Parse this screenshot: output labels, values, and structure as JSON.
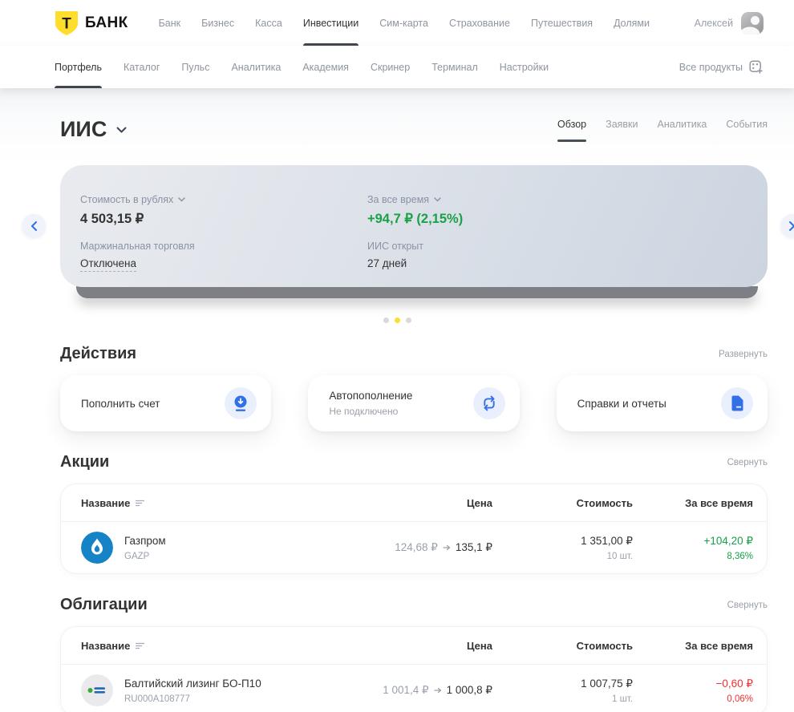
{
  "header": {
    "logo_letter": "Т",
    "logo_text": "БАНК",
    "nav": {
      "items": [
        {
          "label": "Банк"
        },
        {
          "label": "Бизнес"
        },
        {
          "label": "Касса"
        },
        {
          "label": "Инвестиции",
          "active": true
        },
        {
          "label": "Сим-карта"
        },
        {
          "label": "Страхование"
        },
        {
          "label": "Путешествия"
        },
        {
          "label": "Долями"
        }
      ]
    },
    "user_name": "Алексей"
  },
  "subnav": {
    "items": [
      {
        "label": "Портфель",
        "active": true
      },
      {
        "label": "Каталог"
      },
      {
        "label": "Пульс"
      },
      {
        "label": "Аналитика"
      },
      {
        "label": "Академия"
      },
      {
        "label": "Скринер"
      },
      {
        "label": "Терминал"
      },
      {
        "label": "Настройки"
      }
    ],
    "all_products_label": "Все продукты"
  },
  "account": {
    "title": "ИИС",
    "tabs": [
      {
        "label": "Обзор",
        "active": true
      },
      {
        "label": "Заявки"
      },
      {
        "label": "Аналитика"
      },
      {
        "label": "События"
      }
    ],
    "summary": {
      "value_label": "Стоимость в рублях",
      "value": "4 503,15 ₽",
      "period_label": "За все время",
      "period_change": "+94,7 ₽ (2,15%)",
      "margin_label": "Маржинальная торговля",
      "margin_value": "Отключена",
      "opened_label": "ИИС открыт",
      "opened_value": "27 дней"
    },
    "carousel": {
      "dot_count": 3,
      "active_dot": 2
    }
  },
  "actions": {
    "title": "Действия",
    "expand_label": "Развернуть",
    "cards": [
      {
        "label": "Пополнить счет",
        "icon": "download-circle"
      },
      {
        "label": "Автопополнение",
        "sublabel": "Не подключено",
        "icon": "repeat-arrows"
      },
      {
        "label": "Справки и отчеты",
        "icon": "document"
      }
    ]
  },
  "stocks": {
    "title": "Акции",
    "collapse_label": "Свернуть",
    "columns": {
      "name": "Название",
      "price": "Цена",
      "value": "Стоимость",
      "period": "За все время"
    },
    "rows": [
      {
        "name": "Газпром",
        "ticker": "GAZP",
        "price_from": "124,68 ₽",
        "price_to": "135,1 ₽",
        "value": "1 351,00 ₽",
        "quantity": "10 шт.",
        "change": "+104,20 ₽",
        "change_pct": "8,36%",
        "trend": "up"
      }
    ]
  },
  "bonds": {
    "title": "Облигации",
    "collapse_label": "Свернуть",
    "columns": {
      "name": "Название",
      "price": "Цена",
      "value": "Стоимость",
      "period": "За все время"
    },
    "rows": [
      {
        "name": "Балтийский лизинг БО-П10",
        "ticker": "RU000A108777",
        "price_from": "1 001,4 ₽",
        "price_to": "1 000,8 ₽",
        "value": "1 007,75 ₽",
        "quantity": "1 шт.",
        "change": "−0,60 ₽",
        "change_pct": "0,06%",
        "trend": "down"
      }
    ]
  },
  "colors": {
    "brand_yellow": "#ffdd2d",
    "gain_green": "#19a147",
    "loss_red": "#f42f2f",
    "action_blue": "#3270e8",
    "gazprom_blue": "#1583c5"
  }
}
